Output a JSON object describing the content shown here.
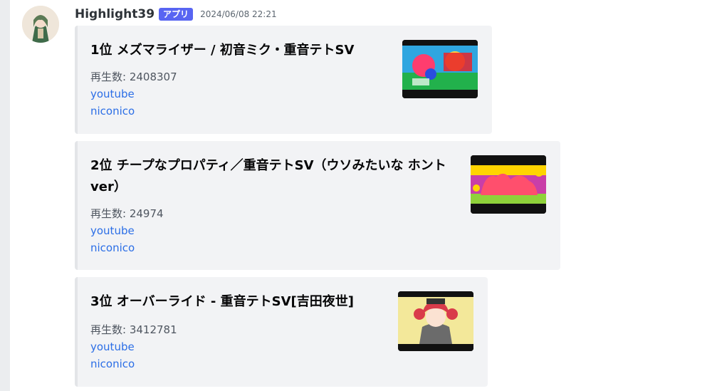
{
  "message": {
    "username": "Highlight39",
    "badge": "アプリ",
    "timestamp": "2024/06/08 22:21"
  },
  "embeds": [
    {
      "title": "1位 メズマライザー / 初音ミク・重音テトSV",
      "plays_label": "再生数: 2408307",
      "youtube": "youtube",
      "niconico": "niconico"
    },
    {
      "title": "2位 チープなプロパティ／重音テトSV（ウソみたいな ホントver）",
      "plays_label": "再生数: 24974",
      "youtube": "youtube",
      "niconico": "niconico"
    },
    {
      "title": "3位 オーバーライド - 重音テトSV[吉田夜世]",
      "plays_label": "再生数: 3412781",
      "youtube": "youtube",
      "niconico": "niconico"
    }
  ],
  "colors": {
    "badge": "#5865f2",
    "link": "#2b6ee6",
    "embed_bg": "#f2f3f5"
  }
}
